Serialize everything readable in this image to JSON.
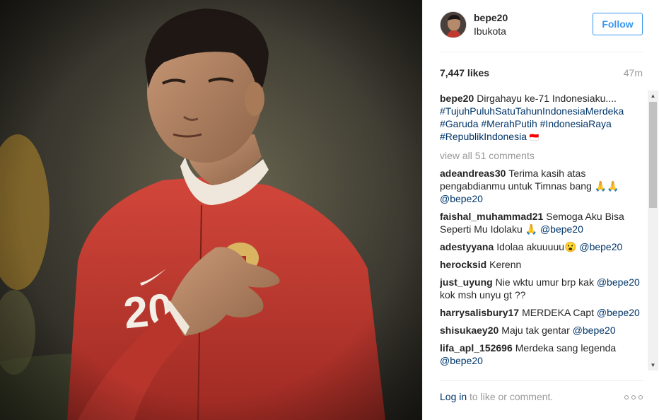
{
  "post": {
    "username": "bepe20",
    "location": "Ibukota",
    "follow_label": "Follow",
    "likes": "7,447 likes",
    "time_ago": "47m",
    "caption": {
      "user": "bepe20",
      "text": "Dirgahayu ke-71 Indonesiaku....",
      "hashtags": "#TujuhPuluhSatuTahunIndonesiaMerdeka #Garuda #MerahPutih #IndonesiaRaya #RepublikIndonesia",
      "flag": "🇮🇩"
    },
    "view_all": "view all 51 comments",
    "comments": [
      {
        "user": "adeandreas30",
        "text": "Terima kasih atas pengabdianmu untuk Timnas bang 🙏🙏",
        "mention": "@bepe20"
      },
      {
        "user": "faishal_muhammad21",
        "text": "Semoga Aku Bisa Seperti Mu Idolaku 🙏",
        "mention": "@bepe20"
      },
      {
        "user": "adestyyana",
        "text": "Idolaa akuuuuu😮",
        "mention": "@bepe20"
      },
      {
        "user": "herocksid",
        "text": "Kerenn",
        "mention": ""
      },
      {
        "user": "just_uyung",
        "text": "Nie wktu umur brp kak",
        "mention": "@bepe20",
        "after": "kok msh unyu gt ??"
      },
      {
        "user": "harrysalisbury17",
        "text": "MERDEKA Capt",
        "mention": "@bepe20"
      },
      {
        "user": "shisukaey20",
        "text": "Maju tak gentar",
        "mention": "@bepe20"
      },
      {
        "user": "lifa_apl_152696",
        "text": "Merdeka sang legenda",
        "mention": "@bepe20"
      }
    ],
    "footer": {
      "login_link": "Log in",
      "login_rest": " to like or comment."
    }
  },
  "photo": {
    "jersey_number": "20"
  },
  "colors": {
    "link": "#003569",
    "follow": "#3897f0",
    "muted": "#999999",
    "jersey": "#c8392e"
  }
}
